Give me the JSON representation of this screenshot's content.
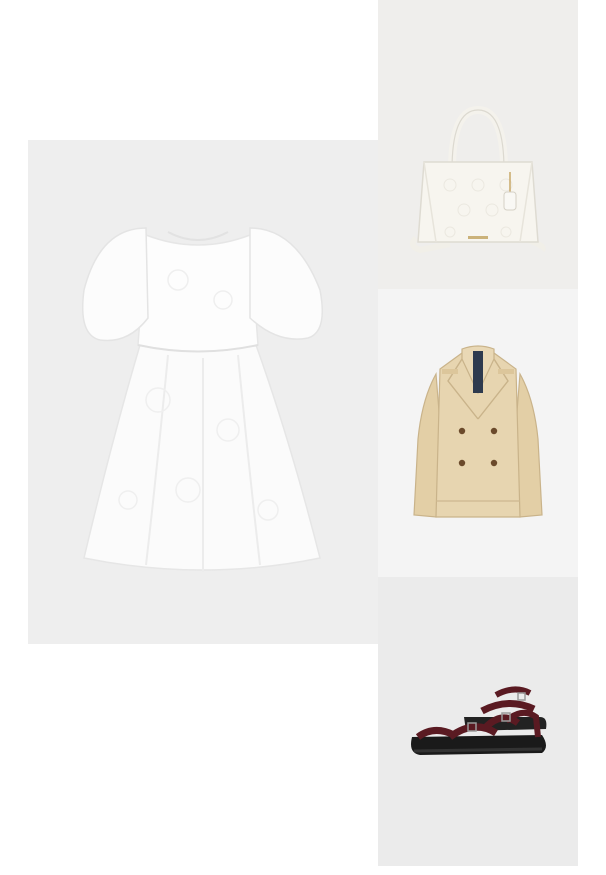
{
  "collage": {
    "items": [
      {
        "icon": "dress-icon",
        "background": "#eeeeee"
      },
      {
        "icon": "tote-bag-icon",
        "background": "#efeeec"
      },
      {
        "icon": "trench-jacket-icon",
        "background": "#f4f4f4"
      },
      {
        "icon": "sandals-icon",
        "background": "#ebebeb"
      }
    ],
    "colors": {
      "dress": "#fbfbfb",
      "bag": "#f7f5ef",
      "jacket": "#e7d5b0",
      "sandal_strap": "#5a1a22",
      "sandal_sole": "#1a1a1a"
    }
  }
}
